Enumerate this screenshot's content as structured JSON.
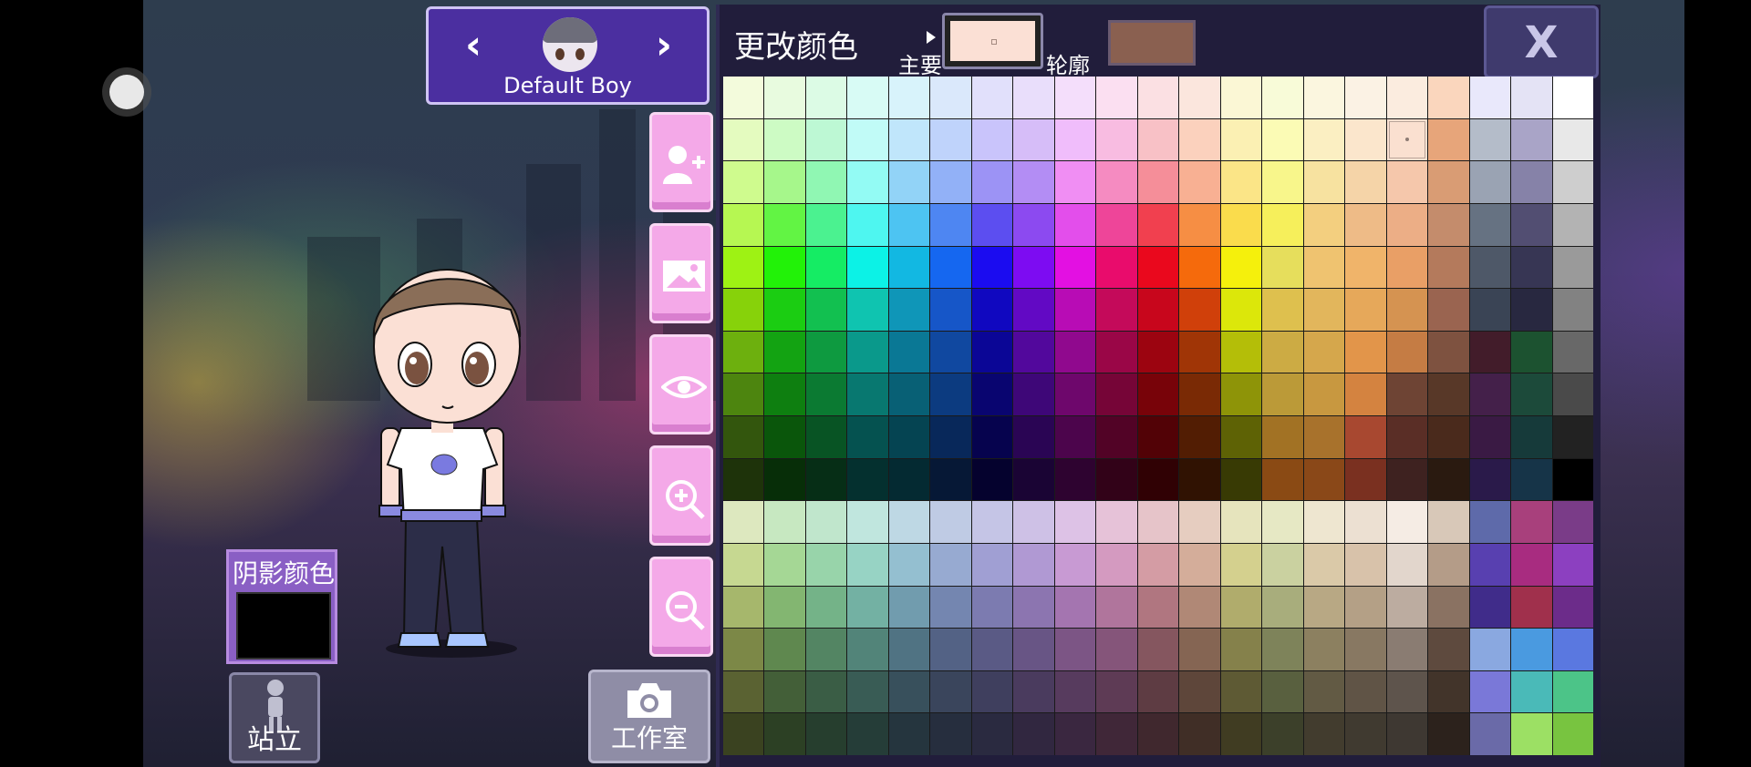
{
  "character": {
    "name": "Default Boy"
  },
  "shadow": {
    "label": "阴影颜色",
    "color": "#000000"
  },
  "buttons": {
    "stand_label": "站立",
    "studio_label": "工作室"
  },
  "panel": {
    "title": "更改颜色",
    "main_label": "主要",
    "outline_label": "轮廓",
    "main_color": "#fbe0d5",
    "outline_color": "#8a6050",
    "close_label": "X"
  },
  "palette": {
    "selected": [
      1,
      16
    ],
    "rows": [
      [
        "#f3fbdc",
        "#e8fbdf",
        "#dcfbe5",
        "#d8fbf5",
        "#d8f3fb",
        "#dae8fb",
        "#e1e0fb",
        "#e9defb",
        "#f4defb",
        "#fbdff1",
        "#fbe0e3",
        "#fbe6dd",
        "#fbf7d5",
        "#f8fbd8",
        "#fbf6df",
        "#fbf2e4",
        "#fbecdf",
        "#fad6bd",
        "#e9e8fb",
        "#e4e3f5",
        "#ffffff"
      ],
      [
        "#e4fbbf",
        "#cdfbc4",
        "#bdf8d4",
        "#c1fbf7",
        "#c0e6fb",
        "#bfd3fb",
        "#c9c4fb",
        "#d6bdf8",
        "#f0bdfb",
        "#f8bce1",
        "#f8c1c6",
        "#fbd1bd",
        "#fbf0b3",
        "#fbfbb5",
        "#fbefc2",
        "#fbe6cc",
        "#fae0d0",
        "#e7a57a",
        "#b4bcc9",
        "#a9a4c7",
        "#e8e8e8"
      ],
      [
        "#cffb8e",
        "#a6f78b",
        "#90f7b3",
        "#93fbf4",
        "#92d3f7",
        "#92b1f7",
        "#9c93f5",
        "#b38df4",
        "#f08ef3",
        "#f58bc1",
        "#f58e99",
        "#f8b093",
        "#fbe587",
        "#f8f68b",
        "#f7e2a0",
        "#f5d4a8",
        "#f5c7ab",
        "#d99c74",
        "#9aa3b3",
        "#8682a8",
        "#cecece"
      ],
      [
        "#b6f752",
        "#62f444",
        "#4bf290",
        "#4ef6f0",
        "#4dc4f2",
        "#4e86f2",
        "#5c4ef0",
        "#8c4af0",
        "#e34eeb",
        "#ee4599",
        "#f1404f",
        "#f68e44",
        "#fadc4c",
        "#f6ef5b",
        "#f3cf7f",
        "#eebb87",
        "#ecae86",
        "#c48c6c",
        "#667282",
        "#524e72",
        "#b3b3b3"
      ],
      [
        "#9ef214",
        "#22f208",
        "#15ec64",
        "#0cf2e6",
        "#12b8e2",
        "#1567f0",
        "#1b0cf0",
        "#7d0cf2",
        "#e310e2",
        "#e90c6c",
        "#ea081d",
        "#f56a0c",
        "#f5f00c",
        "#e6de5c",
        "#efc370",
        "#f0b46a",
        "#e99f66",
        "#b47a5c",
        "#4e5868",
        "#373654",
        "#9a9a9a"
      ],
      [
        "#87d20a",
        "#1bcd12",
        "#12c050",
        "#0fc4b0",
        "#0f96b8",
        "#1656c8",
        "#1008c0",
        "#6209c4",
        "#b80cb5",
        "#c40a5a",
        "#c8061c",
        "#d0400a",
        "#dce70a",
        "#dec04e",
        "#e2b65c",
        "#e6a85a",
        "#d59351",
        "#9a6450",
        "#3a4455",
        "#282840",
        "#828282"
      ],
      [
        "#6db00e",
        "#13a312",
        "#0e9a40",
        "#0a998b",
        "#0a7895",
        "#1048a0",
        "#0b0696",
        "#52089c",
        "#90098e",
        "#9a0647",
        "#9c0410",
        "#a03506",
        "#b4be08",
        "#ccab44",
        "#d5a74c",
        "#e2954a",
        "#c57c44",
        "#7e5240",
        "#421c2a",
        "#1c5230",
        "#686868"
      ],
      [
        "#4d850f",
        "#0e7f10",
        "#0b7a32",
        "#087870",
        "#086075",
        "#0c3b80",
        "#090570",
        "#3e0778",
        "#6e076c",
        "#760537",
        "#780309",
        "#7a2a05",
        "#8e9408",
        "#bb9a38",
        "#c89840",
        "#d48340",
        "#6e4434",
        "#583828",
        "#44204a",
        "#1c4a3a",
        "#4a4a4a"
      ],
      [
        "#33560d",
        "#0a560b",
        "#085424",
        "#055250",
        "#054452",
        "#08285a",
        "#06034e",
        "#2a0554",
        "#4c054c",
        "#520326",
        "#520206",
        "#521d03",
        "#5e6205",
        "#a27224",
        "#a8722c",
        "#a84830",
        "#5a2e26",
        "#4a2a1c",
        "#3a1a44",
        "#163a3a",
        "#222222"
      ],
      [
        "#1e330a",
        "#072e08",
        "#062e16",
        "#04302f",
        "#042a32",
        "#061836",
        "#05022e",
        "#1a0434",
        "#2e0330",
        "#320218",
        "#300104",
        "#301202",
        "#383a04",
        "#8a4a14",
        "#8a4818",
        "#7a3020",
        "#3e2220",
        "#2a1a10",
        "#2a1a4a",
        "#163448",
        "#000000"
      ],
      [
        "#dde8bf",
        "#c7e8c1",
        "#c0e6cc",
        "#c0e6de",
        "#bed8e4",
        "#bfcbe4",
        "#c5c5e6",
        "#cec1e6",
        "#ddc2e6",
        "#e6c2d8",
        "#e6c4c9",
        "#e6cdc0",
        "#e6e4bd",
        "#e6e8c4",
        "#eee6d0",
        "#ece0d2",
        "#f5ece4",
        "#d8c8b8",
        "#5e6aaa",
        "#a8407c",
        "#7a3c88"
      ],
      [
        "#c6d891",
        "#a5d795",
        "#98d4aa",
        "#97d3c4",
        "#94bfd0",
        "#97aad1",
        "#a09fd3",
        "#b099d3",
        "#c89ad3",
        "#d49ac0",
        "#d49ca4",
        "#d4ad9a",
        "#d4d08e",
        "#cad1a0",
        "#dac9a8",
        "#d8c2aa",
        "#e2d6cc",
        "#b49c88",
        "#5840b0",
        "#a82c80",
        "#8c40c0"
      ],
      [
        "#a6b76c",
        "#83b671",
        "#74b388",
        "#73b1a3",
        "#719cae",
        "#7486b0",
        "#7c7bb0",
        "#8c75b0",
        "#a475b0",
        "#b0759c",
        "#b07680",
        "#b08876",
        "#b0ac6c",
        "#a8ad7c",
        "#b8a884",
        "#b4a086",
        "#bcaca0",
        "#8a7262",
        "#402c8a",
        "#a0304c",
        "#6c2c8a"
      ],
      [
        "#7c8847",
        "#5f884f",
        "#538563",
        "#528479",
        "#507383",
        "#536285",
        "#5a5a85",
        "#685585",
        "#7c5585",
        "#85557a",
        "#85565f",
        "#856553",
        "#85814b",
        "#7e835a",
        "#8c8060",
        "#887862",
        "#8a7c72",
        "#5e4a3e",
        "#8aa8e0",
        "#4a9ae0",
        "#5a78e0"
      ],
      [
        "#5a6232",
        "#435f38",
        "#3a5d45",
        "#395c55",
        "#38505c",
        "#3a455c",
        "#3f3f5e",
        "#4a3b5e",
        "#573b5e",
        "#5e3b55",
        "#5e3c43",
        "#5e463a",
        "#5e5a34",
        "#59603f",
        "#625a44",
        "#605446",
        "#5e544c",
        "#42342a",
        "#7a78d8",
        "#4abab8",
        "#4cc488"
      ],
      [
        "#3a4220",
        "#2c4024",
        "#263e2e",
        "#253d38",
        "#25353e",
        "#262e3e",
        "#2a2a40",
        "#312740",
        "#3a2740",
        "#402738",
        "#40282e",
        "#402e26",
        "#403c22",
        "#3c402a",
        "#423c2e",
        "#403a30",
        "#3e3832",
        "#2c221c",
        "#6a6aa8",
        "#9ce064",
        "#78c440"
      ]
    ]
  }
}
